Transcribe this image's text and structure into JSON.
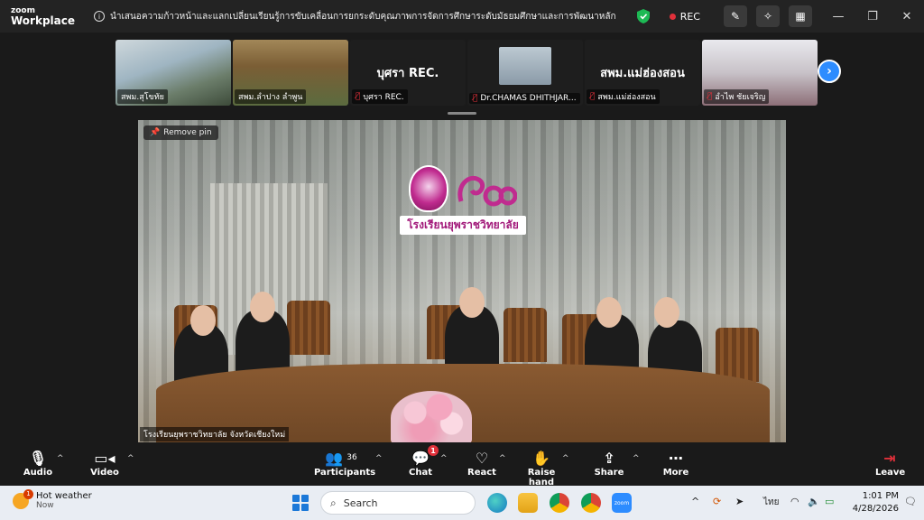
{
  "titlebar": {
    "brand_top": "zoom",
    "brand_bottom": "Workplace",
    "meeting_title": "นำเสนอความก้าวหน้าและแลกเปลี่ยนเรียนรู้การขับเคลื่อนการยกระดับคุณภาพการจัดการศึกษาระดับมัธยมศึกษาและการพัฒนาหลักสูตรสถานศึกษา",
    "rec_label": "REC",
    "shield_color": "#1db954"
  },
  "thumbnails": [
    {
      "name": "สพม.สุโขทัย",
      "muted": false
    },
    {
      "name": "สพม.ลำปาง ลำพูน",
      "muted": false
    },
    {
      "name": "บุศรา REC.",
      "big_name": "บุศรา REC.",
      "muted": true
    },
    {
      "name": "Dr.CHAMAS DHITHJAR...",
      "muted": true
    },
    {
      "name": "สพม.แม่ฮ่องสอน",
      "big_name": "สพม.แม่ฮ่องสอน",
      "muted": true
    },
    {
      "name": "อำไพ ชัยเจริญ",
      "muted": true
    }
  ],
  "main_video": {
    "remove_pin": "Remove pin",
    "participant_label": "โรงเรียนยุพราชวิทยาลัย จังหวัดเชียงใหม่",
    "school_sign": "โรงเรียนยุพราชวิทยาลัย"
  },
  "controls": {
    "audio": "Audio",
    "video": "Video",
    "participants": "Participants",
    "participants_count": "36",
    "chat": "Chat",
    "chat_badge": "1",
    "react": "React",
    "raise_hand": "Raise hand",
    "share": "Share",
    "more": "More",
    "leave": "Leave"
  },
  "taskbar": {
    "weather_title": "Hot weather",
    "weather_sub": "Now",
    "weather_badge": "1",
    "search_placeholder": "Search",
    "lang": "ไทย",
    "time": "1:01 PM",
    "date": "4/28/2026"
  },
  "colors": {
    "accent": "#2d8cff",
    "rec": "#e0303a",
    "leave": "#e0303a"
  }
}
